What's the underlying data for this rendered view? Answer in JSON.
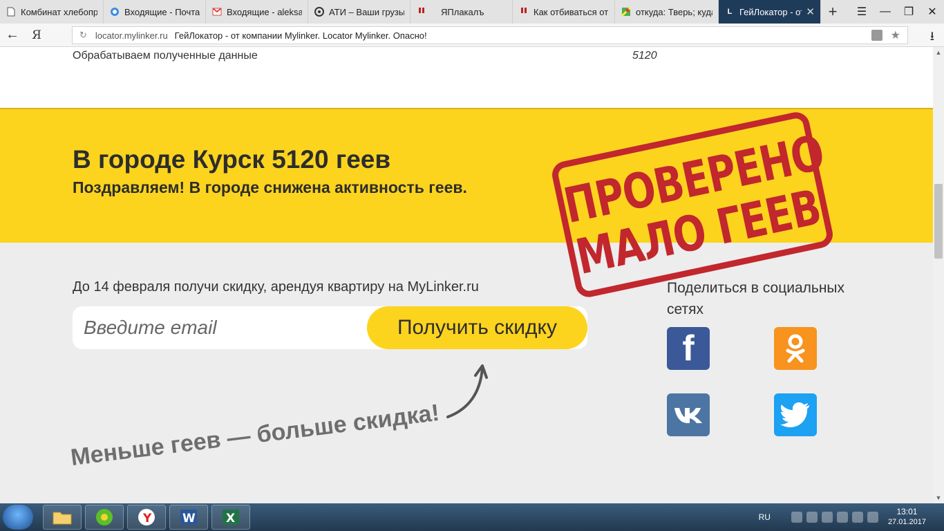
{
  "browser": {
    "tabs": [
      {
        "title": "Комбинат хлебопр",
        "icon": "page-icon"
      },
      {
        "title": "Входящие - Почта",
        "icon": "mail-icon"
      },
      {
        "title": "Входящие - aleksar",
        "icon": "gmail-icon"
      },
      {
        "title": "АТИ – Ваши грузы",
        "icon": "ati-icon"
      },
      {
        "title": "ЯПлакалъ",
        "icon": "yaplakal-icon"
      },
      {
        "title": "Как отбиваться от",
        "icon": "yaplakal-icon"
      },
      {
        "title": "откуда: Тверь; куда",
        "icon": "maps-icon"
      },
      {
        "title": "ГейЛокатор - от",
        "icon": "locator-icon",
        "icon_letter": "L",
        "active": true
      }
    ],
    "address": {
      "domain": "locator.mylinker.ru",
      "page_title": "ГейЛокатор - от компании Mylinker. Locator Mylinker. Опасно!"
    },
    "yandex_button": "Я"
  },
  "page": {
    "processing": {
      "label": "Обрабатываем полученные данные",
      "value": "5120"
    },
    "banner": {
      "title": "В городе Курск 5120 геев",
      "subtitle": "Поздравляем! В городе снижена активность геев."
    },
    "stamp": {
      "line1": "ПРОВЕРЕНО",
      "line2": "МАЛО ГЕЕВ"
    },
    "promo": {
      "text": "До 14 февраля получи скидку, арендуя квартиру на MyLinker.ru",
      "email_placeholder": "Введите email",
      "button": "Получить скидку",
      "slogan": "Меньше геев — больше скидка!"
    },
    "share": {
      "title": "Поделиться в социальных сетях"
    }
  },
  "taskbar": {
    "lang": "RU",
    "time": "13:01",
    "date": "27.01.2017"
  }
}
